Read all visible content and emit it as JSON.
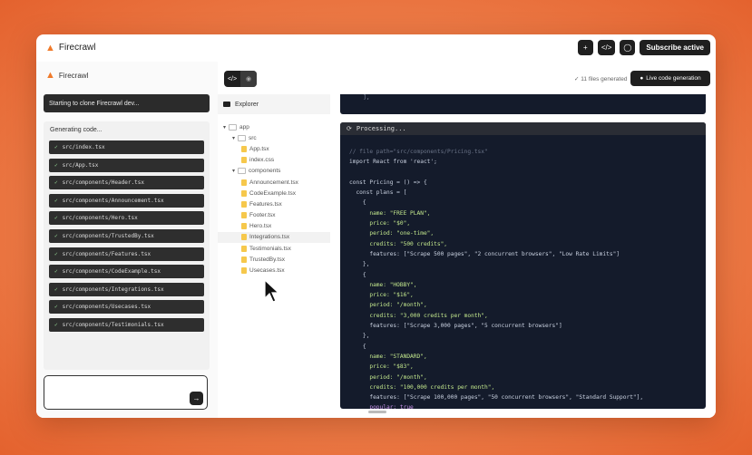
{
  "app": {
    "name": "Firecrawl"
  },
  "topbar": {
    "buttons": [
      "+",
      "</>",
      "◯"
    ],
    "subscription_label": "Subscribe active"
  },
  "left": {
    "brand": "Firecrawl",
    "status": "Starting to clone Firecrawl dev...",
    "generating_title": "Generating code...",
    "files": [
      "src/index.tsx",
      "src/App.tsx",
      "src/components/Header.tsx",
      "src/components/Announcement.tsx",
      "src/components/Hero.tsx",
      "src/components/TrustedBy.tsx",
      "src/components/Features.tsx",
      "src/components/CodeExample.tsx",
      "src/components/Integrations.tsx",
      "src/components/Usecases.tsx",
      "src/components/Testimonials.tsx"
    ],
    "input_placeholder": "",
    "send_label": "→"
  },
  "middle": {
    "toggle": {
      "code": "</>",
      "preview": "◉"
    },
    "explorer_title": "Explorer",
    "tree": [
      {
        "label": "app",
        "kind": "folder-open",
        "indent": 0
      },
      {
        "label": "src",
        "kind": "folder-open",
        "indent": 1
      },
      {
        "label": "App.tsx",
        "kind": "file",
        "indent": 2
      },
      {
        "label": "index.css",
        "kind": "file",
        "indent": 2
      },
      {
        "label": "components",
        "kind": "folder-open",
        "indent": 1
      },
      {
        "label": "Announcement.tsx",
        "kind": "file",
        "indent": 2
      },
      {
        "label": "CodeExample.tsx",
        "kind": "file",
        "indent": 2
      },
      {
        "label": "Features.tsx",
        "kind": "file",
        "indent": 2
      },
      {
        "label": "Footer.tsx",
        "kind": "file",
        "indent": 2
      },
      {
        "label": "Hero.tsx",
        "kind": "file",
        "indent": 2
      },
      {
        "label": "Integrations.tsx",
        "kind": "file",
        "indent": 2,
        "highlight": true
      },
      {
        "label": "Testimonials.tsx",
        "kind": "file",
        "indent": 2
      },
      {
        "label": "TrustedBy.tsx",
        "kind": "file",
        "indent": 2
      },
      {
        "label": "Usecases.tsx",
        "kind": "file",
        "indent": 2
      }
    ]
  },
  "right": {
    "files_generated": "11 files generated",
    "live_button": "Live code generation",
    "code_top_line": "  ],",
    "processing_label": "Processing...",
    "code_lines": [
      {
        "t": "// file path=\"src/components/Pricing.tsx\"",
        "c": "com"
      },
      {
        "t": "import React from 'react';",
        "c": ""
      },
      {
        "t": "",
        "c": ""
      },
      {
        "t": "const Pricing = () => {",
        "c": ""
      },
      {
        "t": "  const plans = [",
        "c": ""
      },
      {
        "t": "    {",
        "c": ""
      },
      {
        "t": "      name: \"FREE PLAN\",",
        "c": "str"
      },
      {
        "t": "      price: \"$0\",",
        "c": "str"
      },
      {
        "t": "      period: \"one-time\",",
        "c": "str"
      },
      {
        "t": "      credits: \"500 credits\",",
        "c": "str"
      },
      {
        "t": "      features: [\"Scrape 500 pages\", \"2 concurrent browsers\", \"Low Rate Limits\"]",
        "c": ""
      },
      {
        "t": "    },",
        "c": ""
      },
      {
        "t": "    {",
        "c": ""
      },
      {
        "t": "      name: \"HOBBY\",",
        "c": "str"
      },
      {
        "t": "      price: \"$16\",",
        "c": "str"
      },
      {
        "t": "      period: \"/month\",",
        "c": "str"
      },
      {
        "t": "      credits: \"3,000 credits per month\",",
        "c": "str"
      },
      {
        "t": "      features: [\"Scrape 3,000 pages\", \"5 concurrent browsers\"]",
        "c": ""
      },
      {
        "t": "    },",
        "c": ""
      },
      {
        "t": "    {",
        "c": ""
      },
      {
        "t": "      name: \"STANDARD\",",
        "c": "str"
      },
      {
        "t": "      price: \"$83\",",
        "c": "str"
      },
      {
        "t": "      period: \"/month\",",
        "c": "str"
      },
      {
        "t": "      credits: \"100,000 credits per month\",",
        "c": "str"
      },
      {
        "t": "      features: [\"Scrape 100,000 pages\", \"50 concurrent browsers\", \"Standard Support\"],",
        "c": ""
      },
      {
        "t": "      popular: true",
        "c": "key"
      },
      {
        "t": "    },",
        "c": ""
      },
      {
        "t": "    {",
        "c": ""
      },
      {
        "t": "      name",
        "c": ""
      }
    ]
  }
}
